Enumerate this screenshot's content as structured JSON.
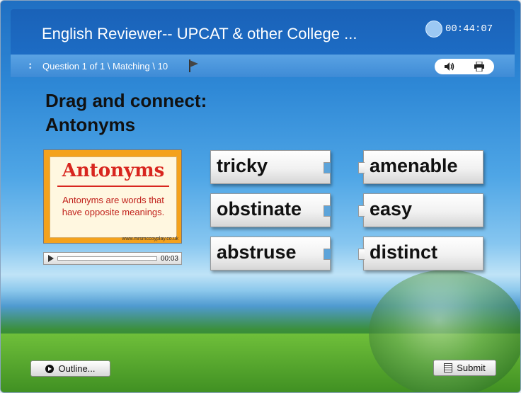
{
  "window": {
    "title": "English Reviewer-- UPCAT & other College  ...",
    "timer": "00:44:07"
  },
  "subbar": {
    "breadcrumb": "Question 1 of 1 \\ Matching \\ 10"
  },
  "icons": {
    "timer": "clock-icon",
    "flag": "flag-icon",
    "audio": "speaker-icon",
    "print": "printer-icon",
    "play": "play-icon",
    "outline": "play-circle-icon",
    "submit": "document-icon"
  },
  "question": {
    "line1": "Drag and connect:",
    "line2": "Antonyms"
  },
  "media": {
    "image_title": "Antonyms",
    "image_caption": "Antonyms are words that have opposite meanings.",
    "image_footer": "www.mrsmccoyplay.co.uk",
    "player_time": "00:03"
  },
  "matching": {
    "left": [
      "tricky",
      "obstinate",
      "abstruse"
    ],
    "right": [
      "amenable",
      "easy",
      "distinct"
    ]
  },
  "footer": {
    "outline_label": "Outline...",
    "submit_label": "Submit"
  }
}
